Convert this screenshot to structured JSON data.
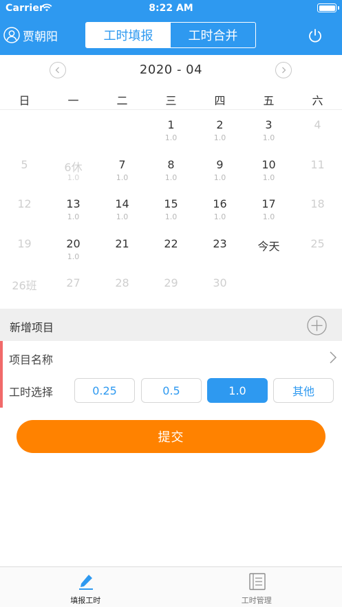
{
  "status_bar": {
    "carrier": "Carrier",
    "time": "8:22 AM"
  },
  "header": {
    "user_name": "贾朝阳",
    "tabs": [
      {
        "label": "工时填报",
        "active": true
      },
      {
        "label": "工时合并",
        "active": false
      }
    ]
  },
  "calendar": {
    "month_label": "2020 - 04",
    "weekdays": [
      "日",
      "一",
      "二",
      "三",
      "四",
      "五",
      "六"
    ],
    "weeks": [
      [
        {
          "d": "",
          "h": "",
          "s": "dark"
        },
        {
          "d": "",
          "h": "",
          "s": "dark"
        },
        {
          "d": "",
          "h": "",
          "s": "dark"
        },
        {
          "d": "1",
          "h": "1.0",
          "s": "dark"
        },
        {
          "d": "2",
          "h": "1.0",
          "s": "dark"
        },
        {
          "d": "3",
          "h": "1.0",
          "s": "dark"
        },
        {
          "d": "4",
          "h": "",
          "s": "light"
        }
      ],
      [
        {
          "d": "5",
          "h": "",
          "s": "light"
        },
        {
          "d": "6休",
          "h": "1.0",
          "s": "light"
        },
        {
          "d": "7",
          "h": "1.0",
          "s": "dark"
        },
        {
          "d": "8",
          "h": "1.0",
          "s": "dark"
        },
        {
          "d": "9",
          "h": "1.0",
          "s": "dark"
        },
        {
          "d": "10",
          "h": "1.0",
          "s": "dark"
        },
        {
          "d": "11",
          "h": "",
          "s": "light"
        }
      ],
      [
        {
          "d": "12",
          "h": "",
          "s": "light"
        },
        {
          "d": "13",
          "h": "1.0",
          "s": "dark"
        },
        {
          "d": "14",
          "h": "1.0",
          "s": "dark"
        },
        {
          "d": "15",
          "h": "1.0",
          "s": "dark"
        },
        {
          "d": "16",
          "h": "1.0",
          "s": "dark"
        },
        {
          "d": "17",
          "h": "1.0",
          "s": "dark"
        },
        {
          "d": "18",
          "h": "",
          "s": "light"
        }
      ],
      [
        {
          "d": "19",
          "h": "",
          "s": "light"
        },
        {
          "d": "20",
          "h": "1.0",
          "s": "dark"
        },
        {
          "d": "21",
          "h": "",
          "s": "dark"
        },
        {
          "d": "22",
          "h": "",
          "s": "dark"
        },
        {
          "d": "23",
          "h": "",
          "s": "dark"
        },
        {
          "d": "今天",
          "h": "",
          "s": "dark"
        },
        {
          "d": "25",
          "h": "",
          "s": "light"
        }
      ],
      [
        {
          "d": "26班",
          "h": "",
          "s": "light"
        },
        {
          "d": "27",
          "h": "",
          "s": "light"
        },
        {
          "d": "28",
          "h": "",
          "s": "light"
        },
        {
          "d": "29",
          "h": "",
          "s": "light"
        },
        {
          "d": "30",
          "h": "",
          "s": "light"
        },
        {
          "d": "",
          "h": "",
          "s": "light"
        },
        {
          "d": "",
          "h": "",
          "s": "light"
        }
      ]
    ]
  },
  "new_project": {
    "label": "新增项目"
  },
  "form": {
    "project_name_label": "项目名称",
    "hours_label": "工时选择",
    "hour_options": [
      {
        "label": "0.25",
        "selected": false
      },
      {
        "label": "0.5",
        "selected": false
      },
      {
        "label": "1.0",
        "selected": true
      },
      {
        "label": "其他",
        "selected": false
      }
    ]
  },
  "submit_label": "提交",
  "tab_bar": {
    "items": [
      {
        "label": "填报工时",
        "active": true
      },
      {
        "label": "工时管理",
        "active": false
      }
    ]
  },
  "colors": {
    "primary": "#2e99f0",
    "accent_orange": "#ff8200",
    "required_mark": "#f16a6a"
  }
}
